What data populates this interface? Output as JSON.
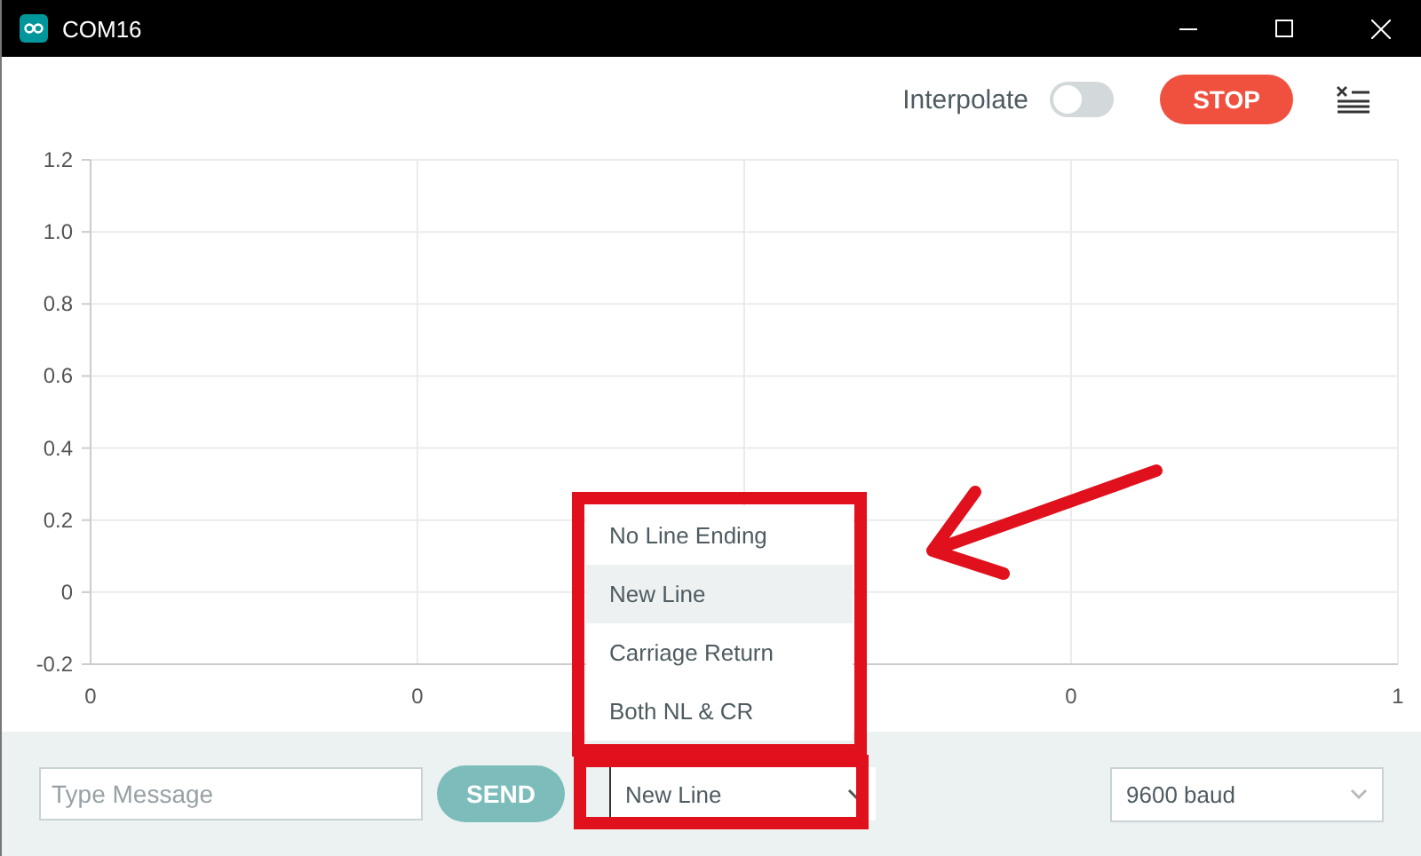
{
  "window": {
    "title": "COM16"
  },
  "toolbar": {
    "interpolate": {
      "label": "Interpolate",
      "on": false
    },
    "stop_button": "STOP"
  },
  "plot": {
    "chart_data": {
      "type": "line",
      "grid": true,
      "xlim": [
        0,
        1
      ],
      "ylim": [
        -0.2,
        1.2
      ],
      "xticks": [
        0,
        1
      ],
      "yticks": [
        {
          "value": 1.2,
          "label": "1.2"
        },
        {
          "value": 1,
          "label": "1.0"
        },
        {
          "value": 0.8,
          "label": "0.8"
        },
        {
          "value": 0.6,
          "label": "0.6"
        },
        {
          "value": 0.4,
          "label": "0.4"
        },
        {
          "value": 0.2,
          "label": "0.2"
        },
        {
          "value": 0,
          "label": "0"
        },
        {
          "value": -0.2,
          "label": "-0.2"
        }
      ]
    },
    "x_axis_inner_labels": [
      "0",
      "0"
    ]
  },
  "message": {
    "placeholder": "Type Message",
    "send_button": "SEND"
  },
  "line_ending": {
    "value": "New Line",
    "expanded": true,
    "options": [
      {
        "label": "No Line Ending",
        "selected": false
      },
      {
        "label": "New Line",
        "selected": true
      },
      {
        "label": "Carriage Return",
        "selected": false
      },
      {
        "label": "Both NL & CR",
        "selected": false
      }
    ]
  },
  "baud": {
    "value": "9600 baud"
  }
}
